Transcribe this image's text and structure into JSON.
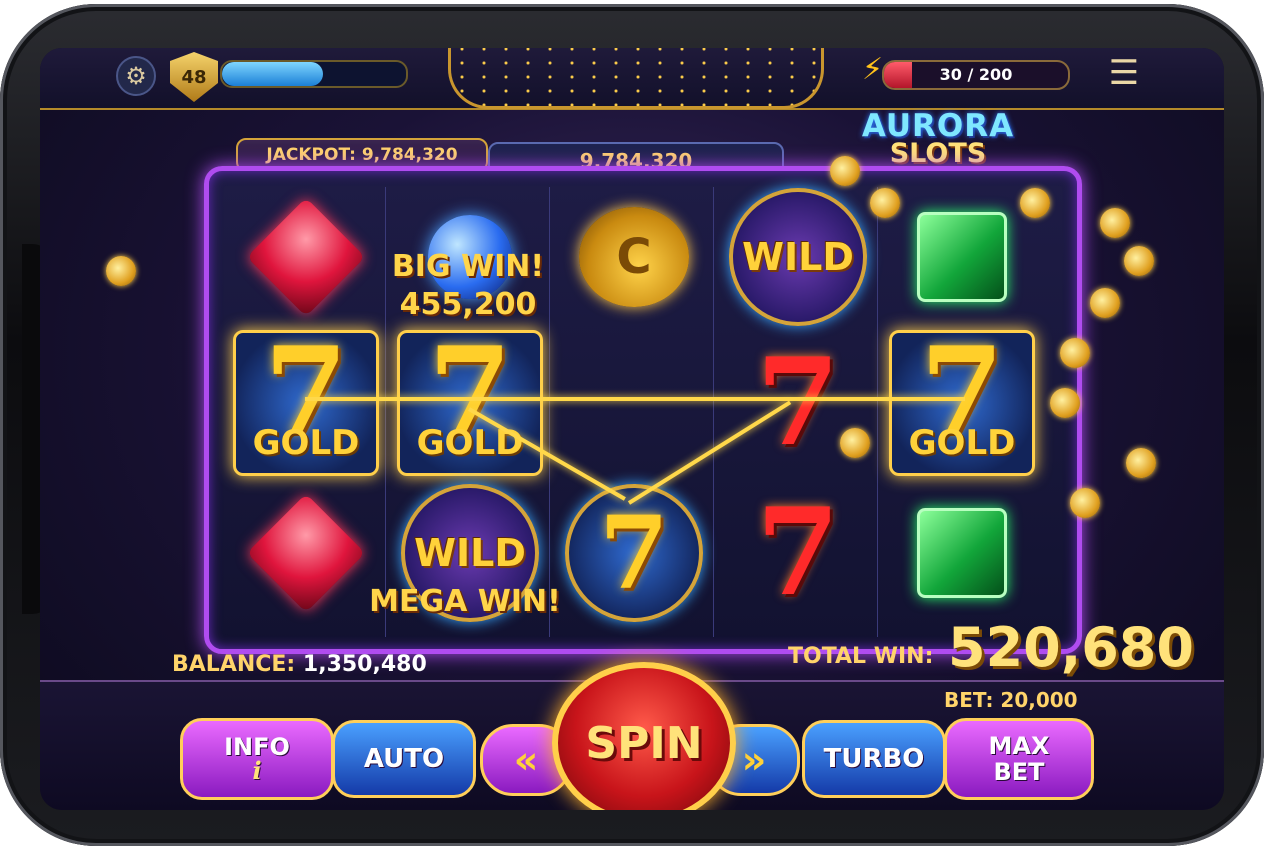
{
  "header": {
    "settings_icon": "gear-icon",
    "level": "48",
    "xp_fraction": 0.55,
    "energy_text": "30 / 200",
    "energy_fraction": 0.15,
    "energy_icon": "lightning-icon",
    "menu_icon": "hamburger-menu-icon"
  },
  "jackpot": {
    "label": "JACKPOT: 9,784,320",
    "value": "9,784,320"
  },
  "logo": {
    "line1": "AURORA",
    "line2": "SLOTS"
  },
  "reels": {
    "wild_text": "WILD",
    "gold_text": "GOLD",
    "seven_glyph": "7",
    "coin_glyph": "C",
    "big_win_line1": "BIG WIN!",
    "big_win_line2": "455,200",
    "mega_win": "MEGA WIN!"
  },
  "status": {
    "balance_label": "BALANCE:",
    "balance_value": "1,350,480",
    "total_win_label": "TOTAL WIN:",
    "total_win_value": "520,680",
    "bet": "BET: 20,000"
  },
  "controls": {
    "info_line1": "INFO",
    "info_line2": "i",
    "auto": "AUTO",
    "spin": "SPIN",
    "turbo": "TURBO",
    "max_line1": "MAX",
    "max_line2": "BET",
    "left_arrow": "«",
    "right_arrow": "»"
  },
  "colors": {
    "frame_accent": "#b04cf0",
    "gold": "#ffcf4a",
    "spin_red": "#c8141a"
  }
}
